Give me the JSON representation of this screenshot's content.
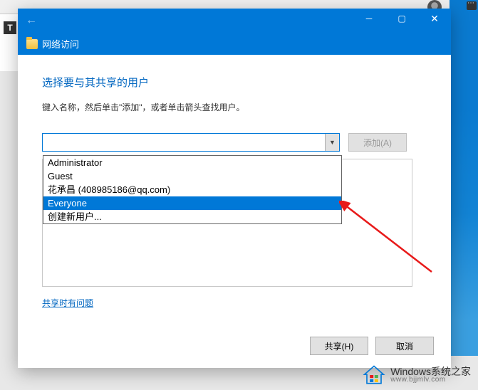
{
  "titlebar": {
    "title": "网络访问"
  },
  "page": {
    "heading": "选择要与其共享的用户",
    "subtext": "键入名称，然后单击\"添加\"，或者单击箭头查找用户。",
    "add_button": "添加(A)",
    "input_value": "",
    "help_link": "共享时有问题"
  },
  "dropdown": {
    "items": [
      {
        "label": "Administrator",
        "selected": false
      },
      {
        "label": "Guest",
        "selected": false
      },
      {
        "label": "花承昌 (408985186@qq.com)",
        "selected": false
      },
      {
        "label": "Everyone",
        "selected": true
      },
      {
        "label": "创建新用户...",
        "selected": false
      }
    ]
  },
  "footer": {
    "share": "共享(H)",
    "cancel": "取消"
  },
  "watermark": {
    "line1": "Windows系统之家",
    "line2": "www.bjjmlv.com"
  }
}
